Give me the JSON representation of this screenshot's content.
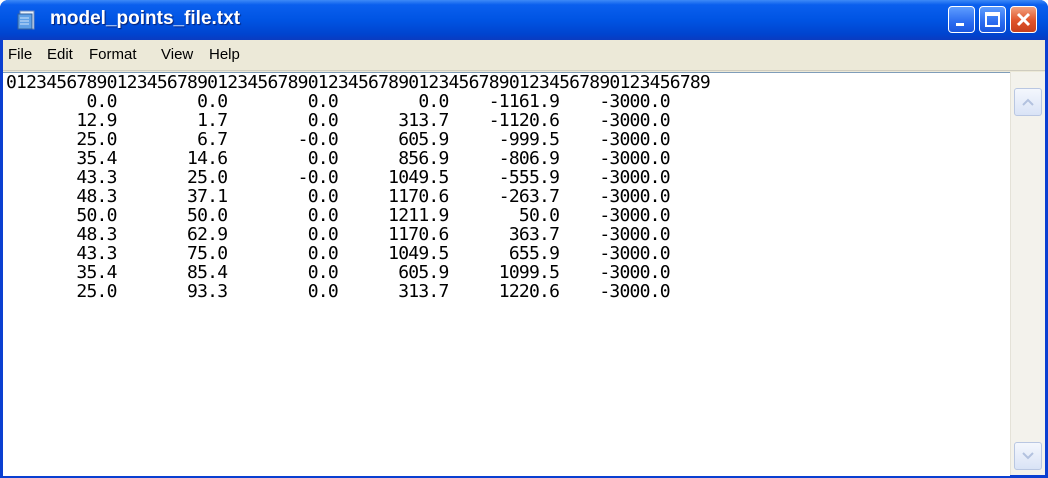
{
  "window": {
    "title": "model_points_file.txt"
  },
  "menu": [
    "File",
    "Edit",
    "Format",
    "View",
    "Help"
  ],
  "content": {
    "lines": [
      "0123456789012345678901234567890123456789012345678901234567890123456789",
      "        0.0        0.0        0.0        0.0    -1161.9    -3000.0",
      "       12.9        1.7        0.0      313.7    -1120.6    -3000.0",
      "       25.0        6.7       -0.0      605.9     -999.5    -3000.0",
      "       35.4       14.6        0.0      856.9     -806.9    -3000.0",
      "       43.3       25.0       -0.0     1049.5     -555.9    -3000.0",
      "       48.3       37.1        0.0     1170.6     -263.7    -3000.0",
      "       50.0       50.0        0.0     1211.9       50.0    -3000.0",
      "       48.3       62.9        0.0     1170.6      363.7    -3000.0",
      "       43.3       75.0        0.0     1049.5      655.9    -3000.0",
      "       35.4       85.4        0.0      605.9     1099.5    -3000.0",
      "       25.0       93.3        0.0      313.7     1220.6    -3000.0"
    ]
  },
  "icons": {
    "app": "notepad-icon",
    "minimize": "minimize-icon",
    "maximize": "maximize-icon",
    "close": "close-icon",
    "scroll_up": "scroll-up-arrow-icon",
    "scroll_down": "scroll-down-arrow-icon"
  },
  "colors": {
    "titlebar": "#0054e3",
    "close_button": "#e0532a",
    "menubar": "#ece9d8",
    "editor_bg": "#ffffff"
  }
}
